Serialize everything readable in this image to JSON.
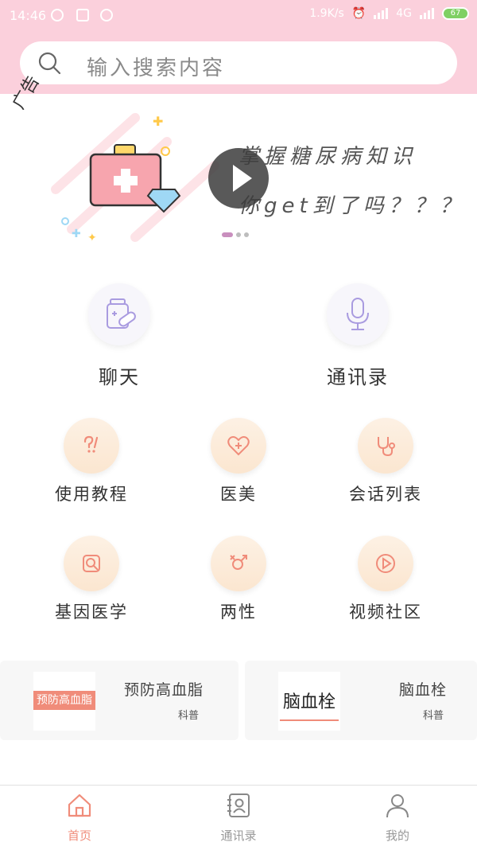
{
  "status_bar": {
    "time": "14:46",
    "net_speed": "1.9K/s",
    "network": "4G",
    "battery": "67"
  },
  "search": {
    "placeholder": "输入搜索内容"
  },
  "banner": {
    "ad_label": "广告",
    "line1": "掌握糖尿病知识",
    "line2": "你get到了吗？？？",
    "slide_count": 3,
    "active_slide": 1
  },
  "quick_access": [
    {
      "label": "聊天",
      "icon": "medicine-bottle-icon"
    },
    {
      "label": "通讯录",
      "icon": "microphone-icon"
    }
  ],
  "services": [
    {
      "label": "使用教程",
      "icon": "question-exclaim-icon"
    },
    {
      "label": "医美",
      "icon": "heart-plus-icon"
    },
    {
      "label": "会话列表",
      "icon": "stethoscope-icon"
    },
    {
      "label": "基因医学",
      "icon": "search-doc-icon"
    },
    {
      "label": "两性",
      "icon": "gender-icon"
    },
    {
      "label": "视频社区",
      "icon": "play-circle-icon"
    }
  ],
  "articles": [
    {
      "title": "预防高血脂",
      "tag": "科普",
      "thumb_text": "预防高血脂"
    },
    {
      "title": "脑血栓",
      "tag": "科普",
      "thumb_text": "脑血栓"
    }
  ],
  "tabbar": [
    {
      "label": "首页",
      "icon": "home-icon",
      "active": true
    },
    {
      "label": "通讯录",
      "icon": "contacts-icon",
      "active": false
    },
    {
      "label": "我的",
      "icon": "user-icon",
      "active": false
    }
  ],
  "colors": {
    "header_pink": "#fbd0dc",
    "accent": "#f08c7a",
    "service_icon": "#f08c7a",
    "quick_icon": "#a99be0"
  }
}
